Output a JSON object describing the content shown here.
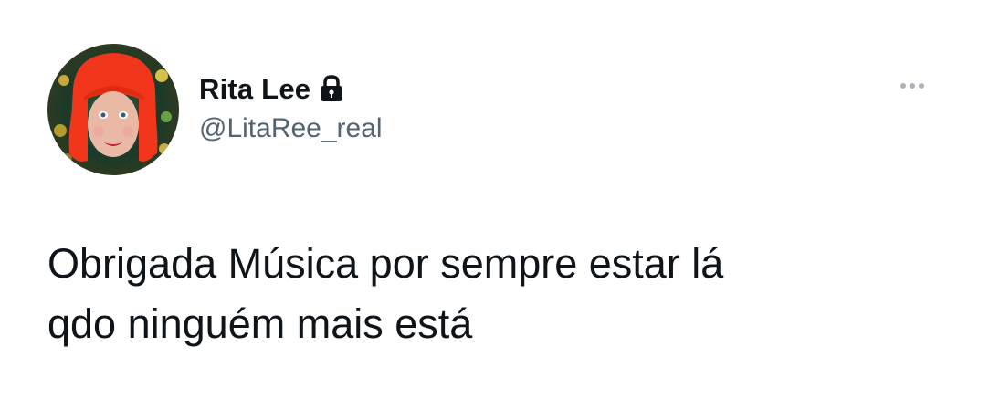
{
  "tweet": {
    "display_name": "Rita Lee",
    "handle": "@LitaRee_real",
    "text_line1": "Obrigada Música por sempre estar lá",
    "text_line2": "qdo ninguém mais está",
    "protected_icon": "lock-icon",
    "more_icon": "more-options-icon"
  },
  "colors": {
    "text_primary": "#0f1419",
    "text_secondary": "#536471",
    "background": "#ffffff"
  }
}
